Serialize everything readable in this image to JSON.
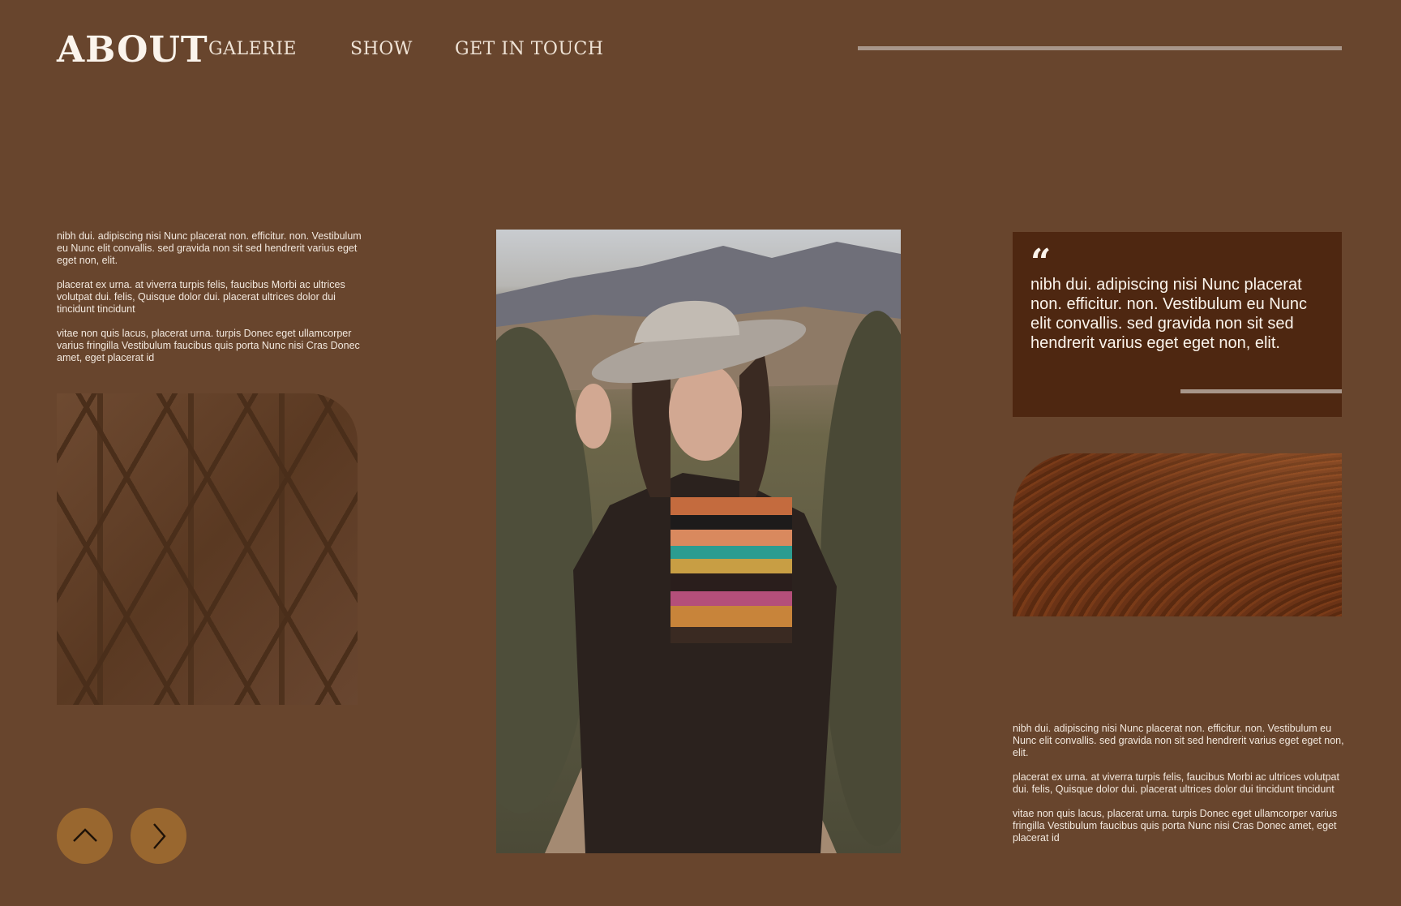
{
  "header": {
    "brand": "ABOUT",
    "nav": [
      "GALERIE",
      "SHOW",
      "GET IN TOUCH"
    ]
  },
  "left": {
    "paragraphs": [
      "nibh dui. adipiscing nisi Nunc placerat non. efficitur. non. Vestibulum eu Nunc elit convallis. sed gravida non sit sed hendrerit varius eget eget non, elit.",
      "placerat ex urna. at viverra turpis felis, faucibus Morbi ac ultrices volutpat dui. felis, Quisque dolor dui. placerat ultrices dolor dui tincidunt tincidunt",
      "vitae non quis lacus, placerat urna. turpis Donec eget ullamcorper varius fringilla Vestibulum faucibus quis porta Nunc nisi Cras Donec amet, eget placerat id"
    ]
  },
  "quote": {
    "mark": "“",
    "text": "nibh dui. adipiscing nisi Nunc placerat non. efficitur. non. Vestibulum eu Nunc elit convallis. sed gravida non sit sed hendrerit varius eget eget non, elit."
  },
  "right": {
    "paragraphs": [
      "nibh dui. adipiscing nisi Nunc placerat non. efficitur. non. Vestibulum eu Nunc elit convallis. sed gravida non sit sed hendrerit varius eget eget non, elit.",
      "placerat ex urna. at viverra turpis felis, faucibus Morbi ac ultrices volutpat dui. felis, Quisque dolor dui. placerat ultrices dolor dui tincidunt tincidunt",
      "vitae non quis lacus, placerat urna. turpis Donec eget ullamcorper varius fringilla Vestibulum faucibus quis porta Nunc nisi Cras Donec amet, eget placerat id"
    ]
  },
  "icons": {
    "up": "chevron-up-icon",
    "next": "chevron-right-icon"
  },
  "colors": {
    "background": "#68452d",
    "quote_card": "#4e2711",
    "button": "#99672f",
    "rule": "#a8968a"
  }
}
